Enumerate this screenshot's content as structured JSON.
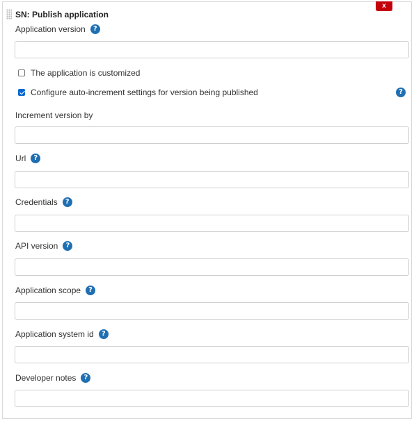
{
  "panel": {
    "title": "SN: Publish application",
    "close_label": "x"
  },
  "help_icon_glyph": "?",
  "fields": {
    "app_version": {
      "label": "Application version",
      "value": ""
    },
    "increment_by": {
      "label": "Increment version by",
      "value": ""
    },
    "url": {
      "label": "Url",
      "value": ""
    },
    "credentials": {
      "label": "Credentials",
      "value": ""
    },
    "api_version": {
      "label": "API version",
      "value": ""
    },
    "app_scope": {
      "label": "Application scope",
      "value": ""
    },
    "app_sys_id": {
      "label": "Application system id",
      "value": ""
    },
    "dev_notes": {
      "label": "Developer notes",
      "value": ""
    }
  },
  "checkboxes": {
    "customized": {
      "label": "The application is customized",
      "checked": false
    },
    "auto_increment": {
      "label": "Configure auto-increment settings for version being published",
      "checked": true
    }
  },
  "colors": {
    "close_button": "#c4000a",
    "help_icon": "#1f6fb3",
    "checkbox_checked": "#0a67d1"
  }
}
